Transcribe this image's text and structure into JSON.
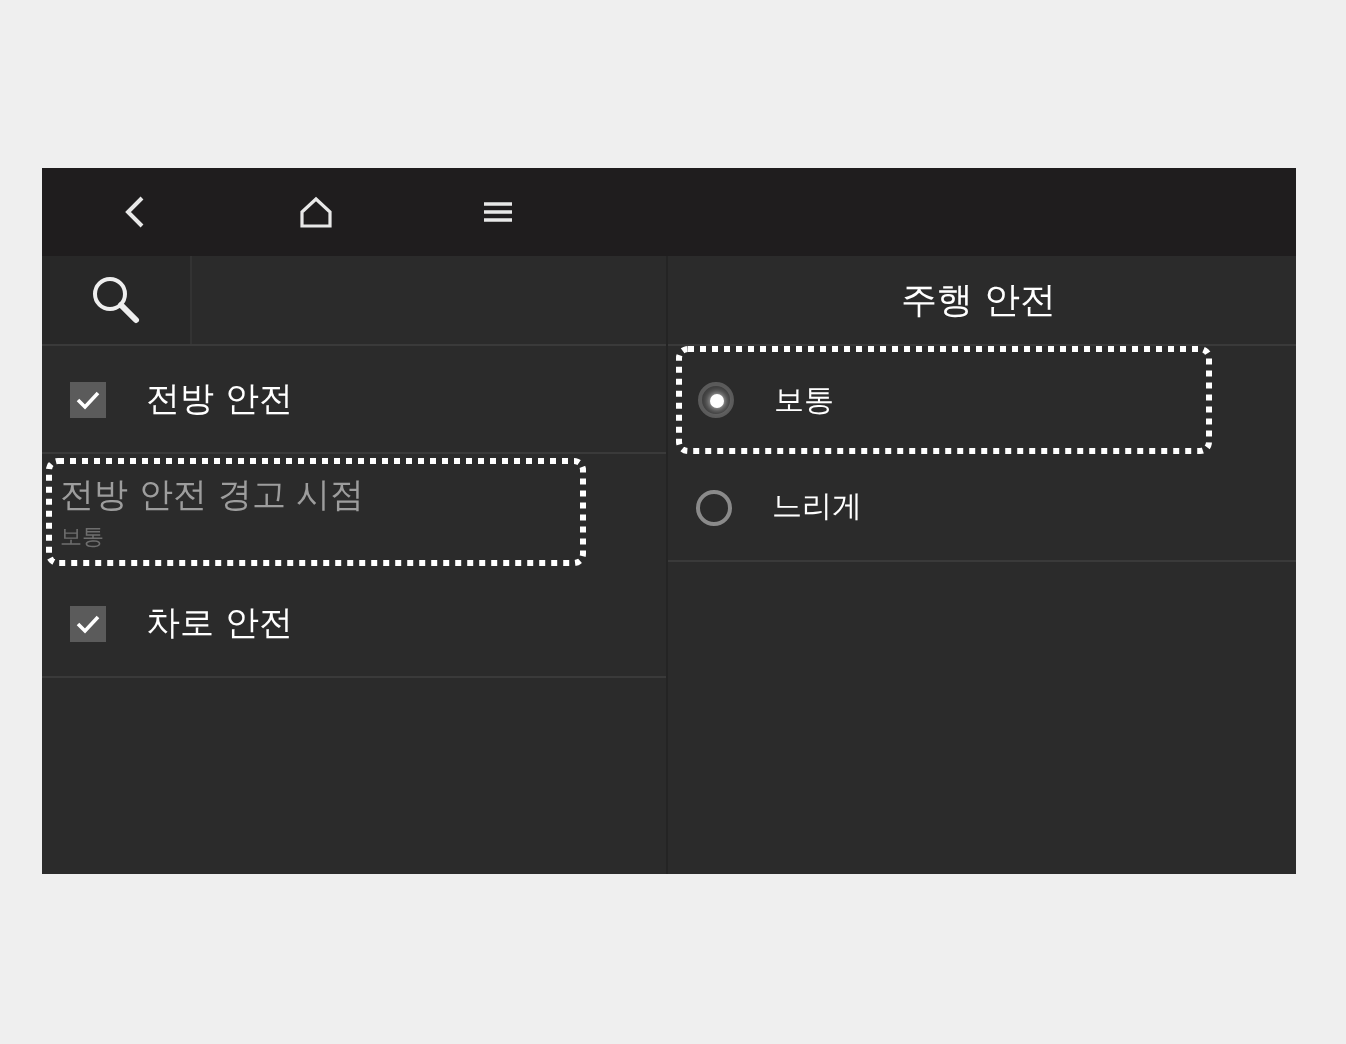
{
  "nav": {
    "buttons": [
      {
        "kind": "back"
      },
      {
        "kind": "home"
      },
      {
        "kind": "menu"
      }
    ]
  },
  "left_panel": {
    "items": [
      {
        "kind": "checkbox",
        "label": "전방 안전",
        "checked": true,
        "highlighted": false
      },
      {
        "kind": "setting",
        "label": "전방 안전 경고 시점",
        "value": "보통",
        "highlighted": true
      },
      {
        "kind": "checkbox",
        "label": "차로 안전",
        "checked": true,
        "highlighted": false
      }
    ]
  },
  "right_panel": {
    "title": "주행 안전",
    "options": [
      {
        "label": "보통",
        "selected": true,
        "highlighted": true
      },
      {
        "label": "느리게",
        "selected": false,
        "highlighted": false
      }
    ]
  }
}
